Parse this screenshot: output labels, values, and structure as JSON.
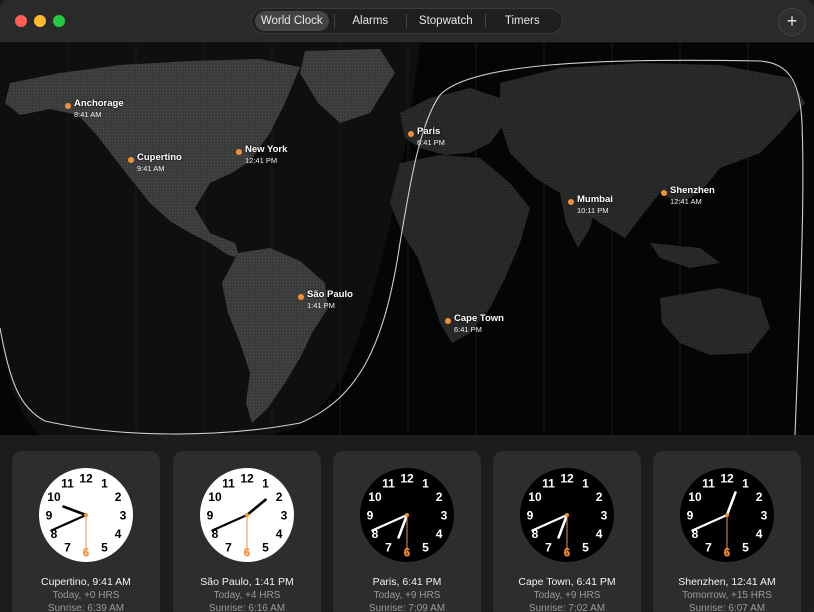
{
  "tabs": [
    {
      "label": "World Clock",
      "active": true
    },
    {
      "label": "Alarms",
      "active": false
    },
    {
      "label": "Stopwatch",
      "active": false
    },
    {
      "label": "Timers",
      "active": false
    }
  ],
  "add_label": "+",
  "cities": [
    {
      "name": "Anchorage",
      "time": "8:41 AM"
    },
    {
      "name": "Cupertino",
      "time": "9:41 AM"
    },
    {
      "name": "New York",
      "time": "12:41 PM"
    },
    {
      "name": "Paris",
      "time": "6:41 PM"
    },
    {
      "name": "Mumbai",
      "time": "10:11 PM"
    },
    {
      "name": "Shenzhen",
      "time": "12:41 AM"
    },
    {
      "name": "São Paulo",
      "time": "1:41 PM"
    },
    {
      "name": "Cape Town",
      "time": "6:41 PM"
    }
  ],
  "clocks": [
    {
      "title": "Cupertino, 9:41 AM",
      "offset": "Today, +0 HRS",
      "sunrise": "Sunrise: 6:39 AM",
      "hour": 9,
      "minute": 41,
      "second": 30,
      "dark": false
    },
    {
      "title": "São Paulo, 1:41 PM",
      "offset": "Today, +4 HRS",
      "sunrise": "Sunrise: 6:16 AM",
      "hour": 1,
      "minute": 41,
      "second": 30,
      "dark": false
    },
    {
      "title": "Paris, 6:41 PM",
      "offset": "Today, +9 HRS",
      "sunrise": "Sunrise: 7:09 AM",
      "hour": 6,
      "minute": 41,
      "second": 30,
      "dark": true
    },
    {
      "title": "Cape Town, 6:41 PM",
      "offset": "Today, +9 HRS",
      "sunrise": "Sunrise: 7:02 AM",
      "hour": 6,
      "minute": 41,
      "second": 30,
      "dark": true
    },
    {
      "title": "Shenzhen, 12:41 AM",
      "offset": "Tomorrow, +15 HRS",
      "sunrise": "Sunrise: 6:07 AM",
      "hour": 12,
      "minute": 41,
      "second": 30,
      "dark": true
    }
  ],
  "dial_numbers": [
    "12",
    "1",
    "2",
    "3",
    "4",
    "5",
    "6",
    "7",
    "8",
    "9",
    "10",
    "11"
  ],
  "colors": {
    "accent": "#f0923a",
    "close": "#ff5f57",
    "minimize": "#febc2e",
    "maximize": "#28c840"
  }
}
